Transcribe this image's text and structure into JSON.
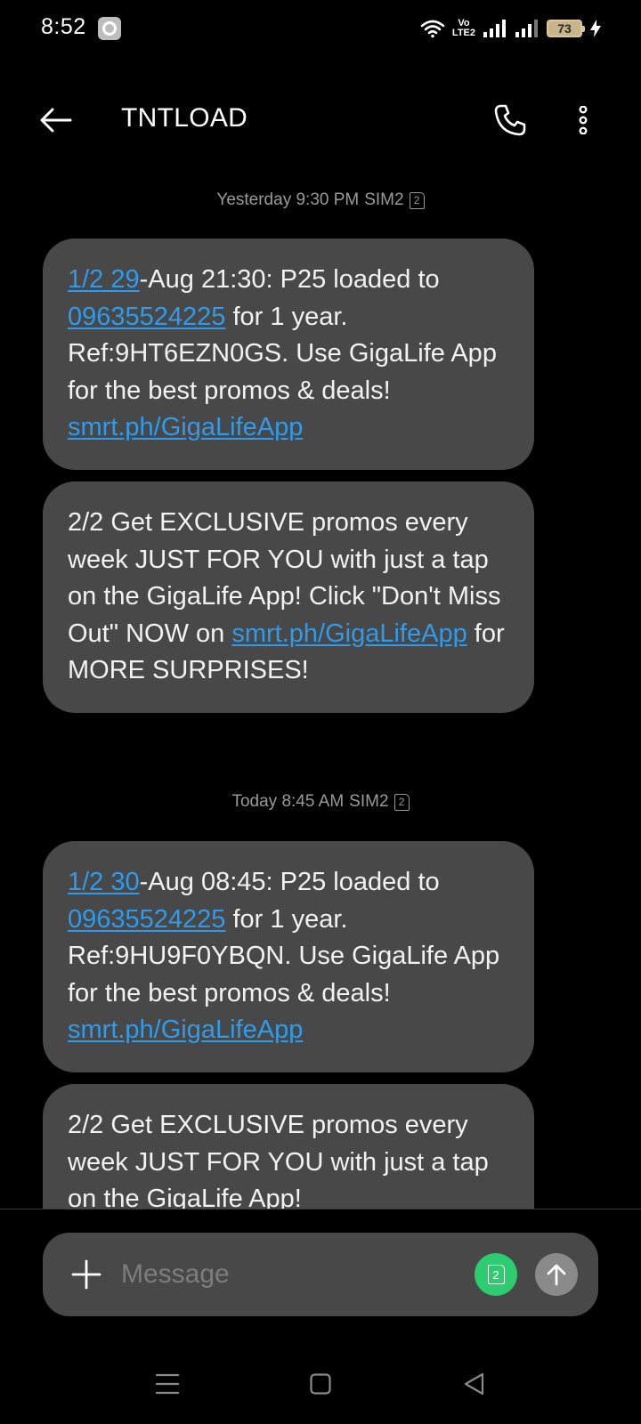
{
  "status_bar": {
    "time": "8:52",
    "volte_label_top": "Vo",
    "volte_label_bottom": "LTE2",
    "battery_level": "73"
  },
  "header": {
    "title": "TNTLOAD"
  },
  "messages": [
    {
      "timestamp": "Yesterday 9:30 PM",
      "sim": "SIM2",
      "sim_number": "2",
      "bubbles": [
        {
          "link1": "1/2 29",
          "text1": "-Aug 21:30: P25 loaded to ",
          "link2": "09635524225",
          "text2": " for 1 year. Ref:9HT6EZN0GS. Use GigaLife App for the best promos & deals! ",
          "link3": "smrt.ph/GigaLifeApp"
        },
        {
          "text1": "2/2 Get EXCLUSIVE promos every week JUST FOR YOU with just a tap on the GigaLife App! Click \"Don't Miss Out\" NOW on ",
          "link1": "smrt.ph/GigaLifeApp",
          "text2": " for MORE SURPRISES!"
        }
      ]
    },
    {
      "timestamp": "Today 8:45 AM",
      "sim": "SIM2",
      "sim_number": "2",
      "bubbles": [
        {
          "link1": "1/2 30",
          "text1": "-Aug 08:45: P25 loaded to ",
          "link2": "09635524225",
          "text2": " for 1 year. Ref:9HU9F0YBQN. Use GigaLife App for the best promos & deals! ",
          "link3": "smrt.ph/GigaLifeApp"
        },
        {
          "text1": "2/2 Get EXCLUSIVE promos every week JUST FOR YOU with just a tap on the GigaLife App!"
        }
      ]
    }
  ],
  "composer": {
    "placeholder": "Message",
    "sim_number": "2"
  },
  "colors": {
    "background": "#000000",
    "bubble": "#484848",
    "link": "#2f9bea",
    "sim_button": "#2ecc71",
    "send_button": "#8a8a8a"
  }
}
